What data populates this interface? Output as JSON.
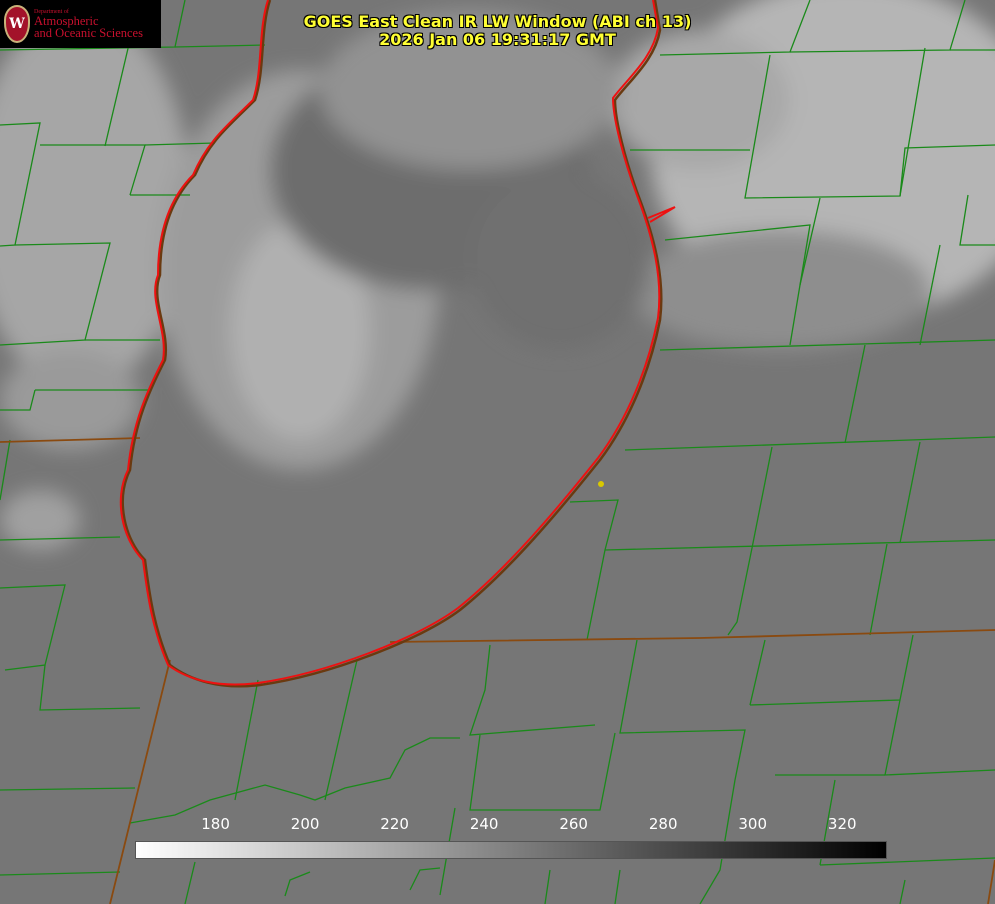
{
  "title": {
    "line1": "GOES East Clean IR LW Window (ABI ch 13)",
    "line2": "2026 Jan 06 19:31:17 GMT"
  },
  "logo": {
    "small": "Department of",
    "line1": "Atmospheric",
    "line2": "and Oceanic Sciences",
    "seal_letter": "W"
  },
  "colorbar": {
    "min": 162,
    "max": 330,
    "ticks": [
      "180",
      "200",
      "220",
      "240",
      "260",
      "280",
      "300",
      "320"
    ],
    "gradient": [
      "#ffffff",
      "#000000"
    ]
  },
  "colors": {
    "background": "#777777",
    "county_lines": "#1a8a1a",
    "state_lines": "#8a4a10",
    "shoreline": "#ee1111",
    "marker": "#d8c800",
    "title": "#ffff33"
  }
}
